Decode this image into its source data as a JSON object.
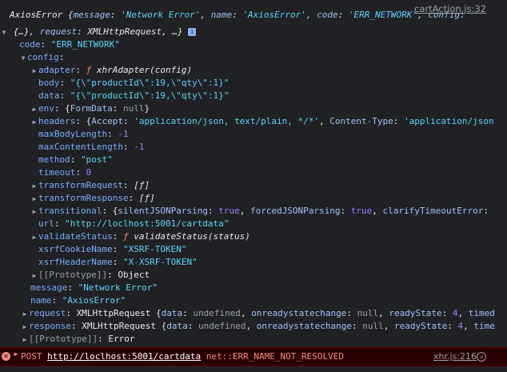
{
  "source_link": "cartAction.js:32",
  "header": {
    "line1": {
      "prefix": "AxiosError {",
      "k1": "message",
      "v1": "'Network Error'",
      "k2": "name",
      "v2": "'AxiosError'",
      "k3": "code",
      "v3": "'ERR_NETWORK'",
      "k4": "config"
    },
    "line2": {
      "p1": "{…}",
      "k1": "request",
      "v1": "XMLHttpRequest",
      "p2": "…}"
    }
  },
  "rows": {
    "code_key": "code",
    "code_val": "\"ERR_NETWORK\"",
    "config_key": "config",
    "adapter_key": "adapter",
    "adapter_val": "xhrAdapter(config)",
    "body_key": "body",
    "body_val": "\"{\\\"productId\\\":19,\\\"qty\\\":1}\"",
    "data_key": "data",
    "data_val": "\"{\\\"productId\\\":19,\\\"qty\\\":1}\"",
    "env_key": "env",
    "env_p": "{",
    "env_fkey": "FormData",
    "env_fval": "null",
    "env_close": "}",
    "headers_key": "headers",
    "headers_p": "{",
    "headers_k1": "Accept",
    "headers_v1": "'application/json, text/plain, */*'",
    "headers_k2": "Content-Type",
    "headers_v2": "'application/json",
    "maxbody_key": "maxBodyLength",
    "maxbody_val": "-1",
    "maxcontent_key": "maxContentLength",
    "maxcontent_val": "-1",
    "method_key": "method",
    "method_val": "\"post\"",
    "timeout_key": "timeout",
    "timeout_val": "0",
    "treq_key": "transformRequest",
    "treq_val": "[ƒ]",
    "tres_key": "transformResponse",
    "tres_val": "[ƒ]",
    "trans_key": "transitional",
    "trans_p": "{",
    "trans_k1": "silentJSONParsing",
    "trans_v1": "true",
    "trans_k2": "forcedJSONParsing",
    "trans_v2": "true",
    "trans_k3": "clarifyTimeoutError",
    "url_key": "url",
    "url_val": "\"http://loclhost:5001/cartdata\"",
    "vs_key": "validateStatus",
    "vs_val": "validateStatus(status)",
    "xcookie_key": "xsrfCookieName",
    "xcookie_val": "\"XSRF-TOKEN\"",
    "xheader_key": "xsrfHeaderName",
    "xheader_val": "\"X-XSRF-TOKEN\"",
    "proto1_key": "[[Prototype]]",
    "proto1_val": "Object",
    "message_key": "message",
    "message_val": "\"Network Error\"",
    "name_key": "name",
    "name_val": "\"AxiosError\"",
    "request_key": "request",
    "request_type": "XMLHttpRequest {",
    "request_k1": "data",
    "request_v1": "undefined",
    "request_k2": "onreadystatechange",
    "request_v2": "null",
    "request_k3": "readyState",
    "request_v3": "4",
    "request_tail": "timed",
    "response_key": "response",
    "response_type": "XMLHttpRequest {",
    "response_k1": "data",
    "response_v1": "undefined",
    "response_k2": "onreadystatechange",
    "response_v2": "null",
    "response_k3": "readyState",
    "response_v3": "4",
    "response_tail": "time",
    "proto2_key": "[[Prototype]]",
    "proto2_val": "Error"
  },
  "error_row": {
    "method": "POST",
    "url": "http://loclhost:5001/cartdata",
    "error": "net::ERR_NAME_NOT_RESOLVED",
    "location": "xhr.js:216"
  },
  "colors": {
    "background": "#202124",
    "key": "#7cacf8",
    "string": "#5cd5fb",
    "number": "#9980ff",
    "function": "#f28b54",
    "error_bg": "#290000",
    "error_text": "#f28b82"
  }
}
